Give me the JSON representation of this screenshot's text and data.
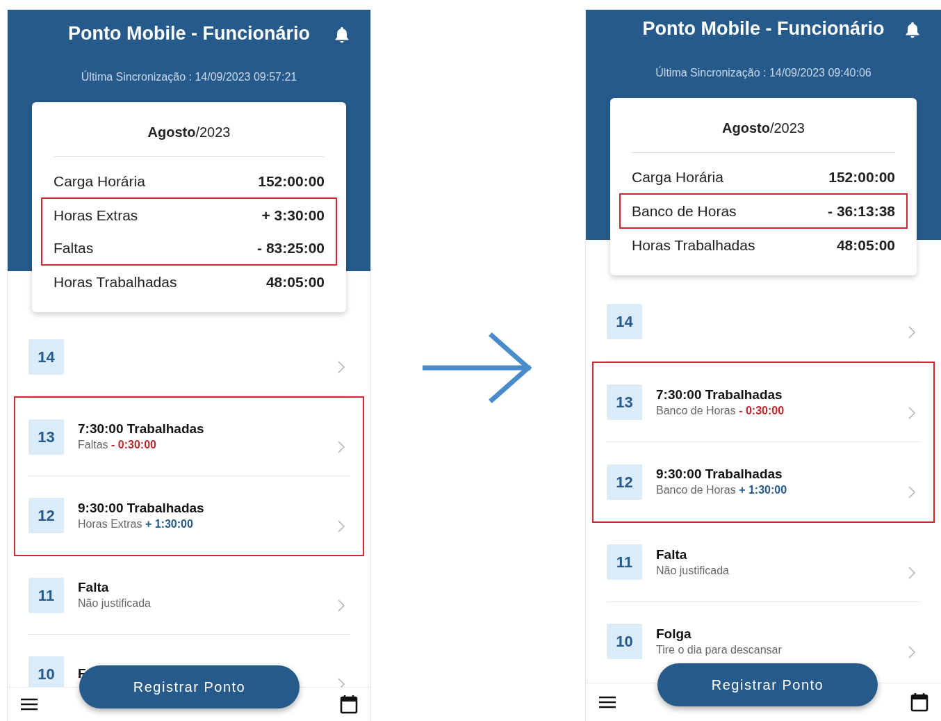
{
  "screens": [
    {
      "title": "Ponto Mobile - Funcionário",
      "sync": "Última Sincronização : 14/09/2023 09:57:21",
      "month": "**Agosto**/2023",
      "summary": [
        {
          "highlighted": false,
          "rows": [
            {
              "label": "Carga Horária",
              "value": "152:00:00"
            }
          ]
        },
        {
          "highlighted": true,
          "rows": [
            {
              "label": "Horas Extras",
              "value": "+ 3:30:00"
            },
            {
              "label": "Faltas",
              "value": "- 83:25:00"
            }
          ]
        },
        {
          "highlighted": false,
          "rows": [
            {
              "label": "Horas Trabalhadas",
              "value": "48:05:00"
            }
          ]
        }
      ],
      "days": [
        {
          "highlighted": false,
          "items": [
            {
              "day": "14"
            }
          ]
        },
        {
          "highlighted": true,
          "items": [
            {
              "day": "13",
              "title": "7:30:00 Trabalhadas",
              "subtitle": "Faltas",
              "delta": "- 0:30:00",
              "negative": true
            },
            {
              "day": "12",
              "title": "9:30:00 Trabalhadas",
              "subtitle": "Horas Extras",
              "delta": "+ 1:30:00",
              "negative": false
            }
          ]
        },
        {
          "highlighted": false,
          "items": [
            {
              "day": "11",
              "title": "Falta",
              "subtitle": "Não justificada"
            },
            {
              "day": "10",
              "title": "F"
            }
          ]
        }
      ],
      "button": "Registrar Ponto"
    },
    {
      "title": "Ponto Mobile - Funcionário",
      "sync": "Última Sincronização : 14/09/2023 09:40:06",
      "month": "**Agosto**/2023",
      "summary": [
        {
          "highlighted": false,
          "rows": [
            {
              "label": "Carga Horária",
              "value": "152:00:00"
            }
          ]
        },
        {
          "highlighted": true,
          "rows": [
            {
              "label": "Banco de Horas",
              "value": "- 36:13:38"
            }
          ]
        },
        {
          "highlighted": false,
          "rows": [
            {
              "label": "Horas Trabalhadas",
              "value": "48:05:00"
            }
          ]
        }
      ],
      "days": [
        {
          "highlighted": false,
          "items": [
            {
              "day": "14"
            }
          ]
        },
        {
          "highlighted": true,
          "items": [
            {
              "day": "13",
              "title": "7:30:00 Trabalhadas",
              "subtitle": "Banco de Horas",
              "delta": "- 0:30:00",
              "negative": true
            },
            {
              "day": "12",
              "title": "9:30:00 Trabalhadas",
              "subtitle": "Banco de Horas",
              "delta": "+ 1:30:00",
              "negative": false
            }
          ]
        },
        {
          "highlighted": false,
          "items": [
            {
              "day": "11",
              "title": "Falta",
              "subtitle": "Não justificada"
            },
            {
              "day": "10",
              "title": "Folga",
              "subtitle": "Tire o dia para descansar"
            }
          ]
        }
      ],
      "button": "Registrar Ponto"
    }
  ]
}
